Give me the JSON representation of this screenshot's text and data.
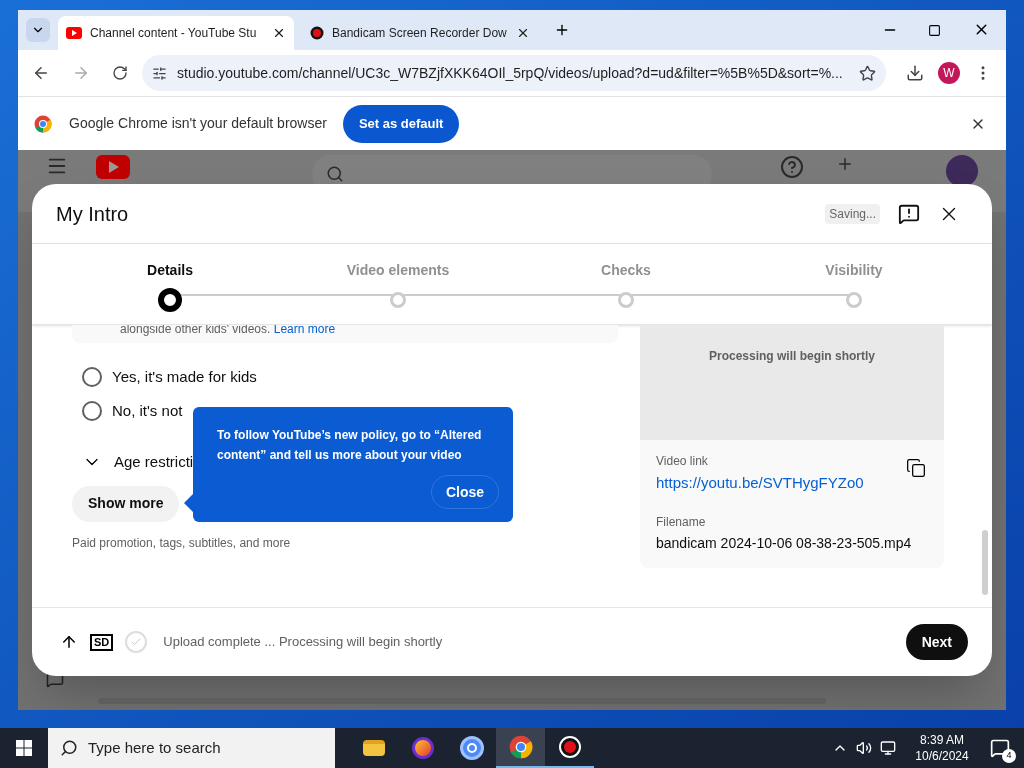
{
  "browser": {
    "tabs": [
      {
        "title": "Channel content - YouTube Stu",
        "selected": true
      },
      {
        "title": "Bandicam Screen Recorder Dow",
        "selected": false
      }
    ],
    "url": "studio.youtube.com/channel/UC3c_W7BZjfXKK64OIl_5rpQ/videos/upload?d=ud&filter=%5B%5D&sort=%...",
    "profile_initial": "W"
  },
  "infobar": {
    "message": "Google Chrome isn't your default browser",
    "button": "Set as default"
  },
  "dialog": {
    "title": "My Intro",
    "saving": "Saving...",
    "steps": [
      {
        "label": "Details",
        "selected": true
      },
      {
        "label": "Video elements",
        "selected": false
      },
      {
        "label": "Checks",
        "selected": false
      },
      {
        "label": "Visibility",
        "selected": false
      }
    ],
    "audience_note": "alongside other kids' videos.",
    "learn_more": "Learn more",
    "options": [
      {
        "label": "Yes, it's made for kids",
        "selected": false
      },
      {
        "label": "No, it's not",
        "selected": false
      }
    ],
    "age_restriction": "Age restricti",
    "show_more": "Show more",
    "show_more_hint": "Paid promotion, tags, subtitles, and more",
    "preview_status": "Processing will begin shortly",
    "video_link_label": "Video link",
    "video_link": "https://youtu.be/SVTHygFYZo0",
    "filename_label": "Filename",
    "filename": "bandicam 2024-10-06 08-38-23-505.mp4",
    "quality_badge": "SD",
    "footer_status": "Upload complete ... Processing will begin shortly",
    "next": "Next"
  },
  "popup": {
    "message": "To follow YouTube’s new policy, go to “Altered content” and tell us more about your video",
    "close": "Close"
  },
  "taskbar": {
    "search_placeholder": "Type here to search",
    "time": "8:39 AM",
    "date": "10/6/2024",
    "notifications": "4"
  }
}
